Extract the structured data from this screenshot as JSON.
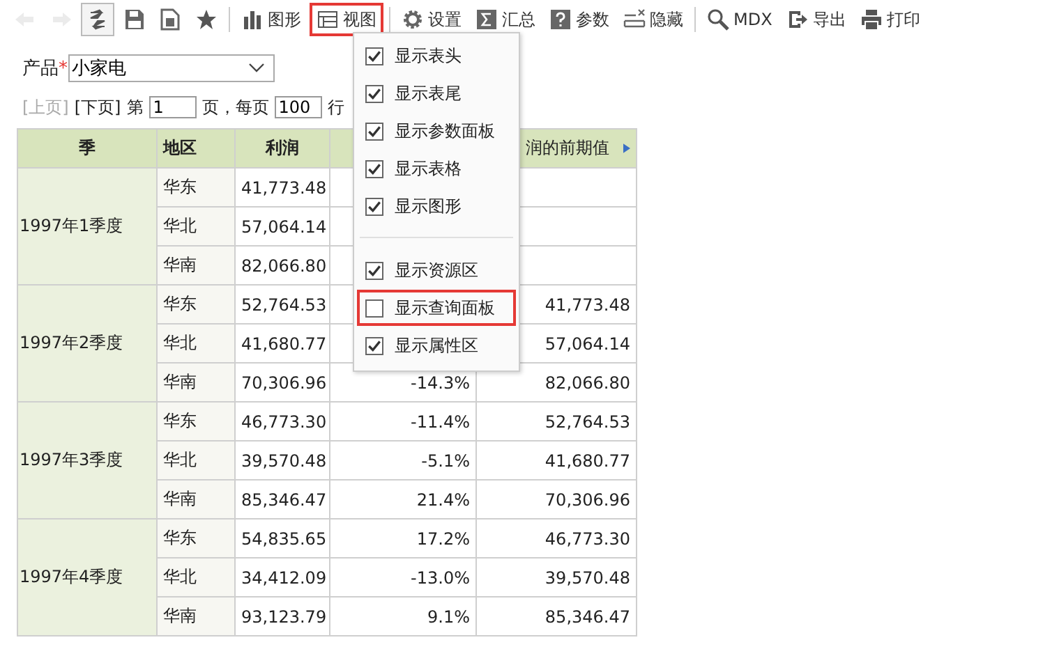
{
  "toolbar": [
    {
      "kind": "back",
      "disabled": true,
      "hovered": false,
      "selected": false
    },
    {
      "kind": "forward",
      "disabled": true,
      "hovered": false,
      "selected": false
    },
    {
      "kind": "refresh",
      "disabled": false,
      "hovered": true,
      "selected": false
    },
    {
      "kind": "save",
      "disabled": false,
      "hovered": false,
      "selected": false
    },
    {
      "kind": "copy",
      "disabled": false,
      "hovered": false,
      "selected": false
    },
    {
      "kind": "star",
      "disabled": false,
      "hovered": false,
      "selected": false
    },
    {
      "kind": "separator"
    },
    {
      "kind": "chart",
      "label": "图形",
      "disabled": false,
      "hovered": false,
      "selected": false
    },
    {
      "kind": "view",
      "label": "视图",
      "disabled": false,
      "hovered": false,
      "selected": true
    },
    {
      "kind": "separator"
    },
    {
      "kind": "gear",
      "label": "设置",
      "disabled": false,
      "hovered": false,
      "selected": false
    },
    {
      "kind": "sigma",
      "label": "汇总",
      "disabled": false,
      "hovered": false,
      "selected": false
    },
    {
      "kind": "question",
      "label": "参数",
      "disabled": false,
      "hovered": false,
      "selected": false
    },
    {
      "kind": "hide",
      "label": "隐藏",
      "disabled": false,
      "hovered": false,
      "selected": false
    },
    {
      "kind": "separator"
    },
    {
      "kind": "search",
      "label": "MDX",
      "disabled": false,
      "hovered": false,
      "selected": false
    },
    {
      "kind": "export",
      "label": "导出",
      "disabled": false,
      "hovered": false,
      "selected": false
    },
    {
      "kind": "print",
      "label": "打印",
      "disabled": false,
      "hovered": false,
      "selected": false
    }
  ],
  "parameter": {
    "label": "产品",
    "required_mark": "*",
    "value": "小家电"
  },
  "pager": {
    "prev": {
      "label": "[上页]",
      "disabled": true
    },
    "next": {
      "label": "[下页]",
      "disabled": false
    },
    "page_prefix": "第",
    "page": "1",
    "page_suffix": "页，每页",
    "page_size": "100",
    "size_suffix": "行"
  },
  "table": {
    "columns": [
      "季",
      "地区",
      "利润",
      null,
      "润的前期值"
    ],
    "rows": [
      {
        "quarter": "1997年1季度",
        "children": [
          {
            "region": "华东",
            "profit": "41,773.48"
          },
          {
            "region": "华北",
            "profit": "57,064.14"
          },
          {
            "region": "华南",
            "profit": "82,066.80"
          }
        ]
      },
      {
        "quarter": "1997年2季度",
        "children": [
          {
            "region": "华东",
            "profit": "52,764.53",
            "previous": "41,773.48"
          },
          {
            "region": "华北",
            "profit": "41,680.77",
            "previous": "57,064.14"
          },
          {
            "region": "华南",
            "profit": "70,306.96",
            "growth": "-14.3%",
            "previous": "82,066.80"
          }
        ]
      },
      {
        "quarter": "1997年3季度",
        "children": [
          {
            "region": "华东",
            "profit": "46,773.30",
            "growth": "-11.4%",
            "previous": "52,764.53"
          },
          {
            "region": "华北",
            "profit": "39,570.48",
            "growth": "-5.1%",
            "previous": "41,680.77"
          },
          {
            "region": "华南",
            "profit": "85,346.47",
            "growth": "21.4%",
            "previous": "70,306.96"
          }
        ]
      },
      {
        "quarter": "1997年4季度",
        "children": [
          {
            "region": "华东",
            "profit": "54,835.65",
            "growth": "17.2%",
            "previous": "46,773.30"
          },
          {
            "region": "华北",
            "profit": "34,412.09",
            "growth": "-13.0%",
            "previous": "39,570.48"
          },
          {
            "region": "华南",
            "profit": "93,123.79",
            "growth": "9.1%",
            "previous": "85,346.47"
          }
        ]
      }
    ]
  },
  "view_menu": [
    {
      "kind": "check",
      "label": "显示表头",
      "checked": true,
      "highlighted": false
    },
    {
      "kind": "check",
      "label": "显示表尾",
      "checked": true,
      "highlighted": false
    },
    {
      "kind": "check",
      "label": "显示参数面板",
      "checked": true,
      "highlighted": false
    },
    {
      "kind": "check",
      "label": "显示表格",
      "checked": true,
      "highlighted": false
    },
    {
      "kind": "check",
      "label": "显示图形",
      "checked": true,
      "highlighted": false
    },
    {
      "kind": "separator"
    },
    {
      "kind": "check",
      "label": "显示资源区",
      "checked": true,
      "highlighted": false
    },
    {
      "kind": "check",
      "label": "显示查询面板",
      "checked": false,
      "highlighted": true
    },
    {
      "kind": "check",
      "label": "显示属性区",
      "checked": true,
      "highlighted": false
    }
  ]
}
